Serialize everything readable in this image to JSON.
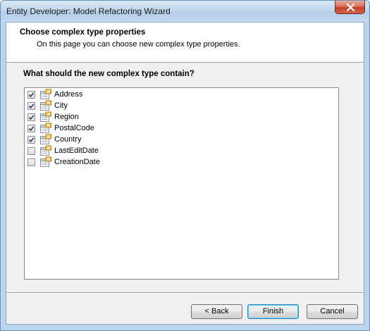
{
  "window": {
    "title": "Entity Developer: Model Refactoring Wizard"
  },
  "header": {
    "title": "Choose complex type properties",
    "subtitle": "On this page you can choose new complex type properties."
  },
  "question": "What should the new complex type contain?",
  "properties": [
    {
      "label": "Address",
      "checked": true
    },
    {
      "label": "City",
      "checked": true
    },
    {
      "label": "Region",
      "checked": true
    },
    {
      "label": "PostalCode",
      "checked": true
    },
    {
      "label": "Country",
      "checked": true
    },
    {
      "label": "LastEditDate",
      "checked": false
    },
    {
      "label": "CreationDate",
      "checked": false
    }
  ],
  "buttons": {
    "back": "< Back",
    "finish": "Finish",
    "cancel": "Cancel"
  },
  "colors": {
    "accent": "#3c7fb1",
    "close_button": "#c2402a",
    "titlebar": "#c2d8ef"
  },
  "icons": {
    "close": "close-icon",
    "property": "property-icon",
    "checkbox": "checkmark-icon"
  }
}
